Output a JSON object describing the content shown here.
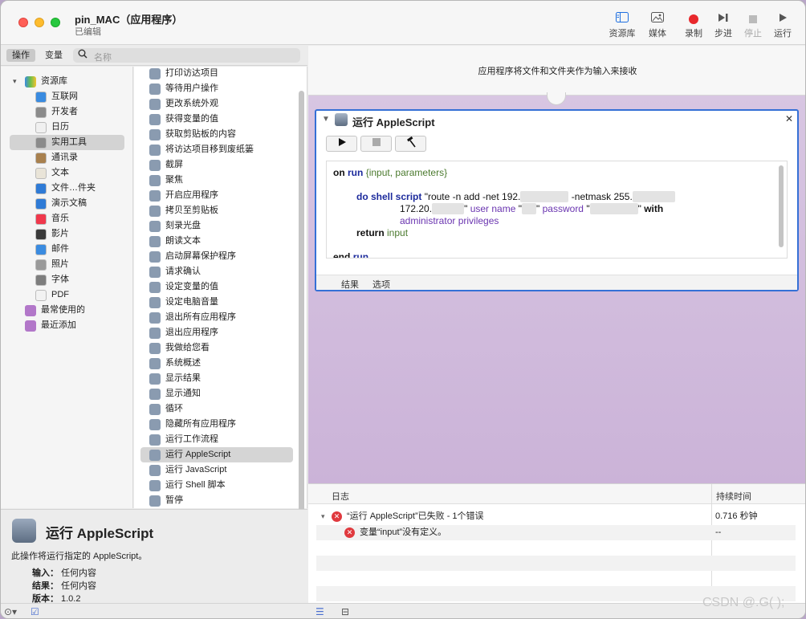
{
  "window": {
    "title": "pin_MAC（应用程序）",
    "subtitle": "已编辑"
  },
  "toolbar": {
    "library_label": "资源库",
    "media_label": "媒体",
    "record_label": "录制",
    "step_label": "步进",
    "stop_label": "停止",
    "run_label": "运行"
  },
  "left_header": {
    "actions_tab": "操作",
    "variables_tab": "变量",
    "search_placeholder": "名称"
  },
  "library": {
    "root_label": "资源库",
    "items": [
      {
        "label": "互联网",
        "color": "#3a8be0"
      },
      {
        "label": "开发者",
        "color": "#8b8b8b"
      },
      {
        "label": "日历",
        "color": "#f0f0f0"
      },
      {
        "label": "实用工具",
        "color": "#8b8b8b",
        "selected": true
      },
      {
        "label": "通讯录",
        "color": "#a8804e"
      },
      {
        "label": "文本",
        "color": "#e9e4d8"
      },
      {
        "label": "文件…件夹",
        "color": "#2f7bd6"
      },
      {
        "label": "演示文稿",
        "color": "#2f7bd6"
      },
      {
        "label": "音乐",
        "color": "#f0384c"
      },
      {
        "label": "影片",
        "color": "#3a3a3a"
      },
      {
        "label": "邮件",
        "color": "#3a8be0"
      },
      {
        "label": "照片",
        "color": "#9a9a9a"
      },
      {
        "label": "字体",
        "color": "#7d7d7d"
      },
      {
        "label": "PDF",
        "color": "#f2f2f2"
      }
    ],
    "smart_groups": [
      {
        "label": "最常使用的",
        "color": "#b277c9"
      },
      {
        "label": "最近添加",
        "color": "#b277c9"
      }
    ]
  },
  "actions": [
    {
      "label": "打印访达项目"
    },
    {
      "label": "等待用户操作"
    },
    {
      "label": "更改系统外观"
    },
    {
      "label": "获得变量的值"
    },
    {
      "label": "获取剪贴板的内容"
    },
    {
      "label": "将访达项目移到废纸篓"
    },
    {
      "label": "截屏"
    },
    {
      "label": "聚焦"
    },
    {
      "label": "开启应用程序"
    },
    {
      "label": "拷贝至剪贴板"
    },
    {
      "label": "刻录光盘"
    },
    {
      "label": "朗读文本"
    },
    {
      "label": "启动屏幕保护程序"
    },
    {
      "label": "请求确认"
    },
    {
      "label": "设定变量的值"
    },
    {
      "label": "设定电脑音量"
    },
    {
      "label": "退出所有应用程序"
    },
    {
      "label": "退出应用程序"
    },
    {
      "label": "我做给您看"
    },
    {
      "label": "系统概述"
    },
    {
      "label": "显示结果"
    },
    {
      "label": "显示通知"
    },
    {
      "label": "循环"
    },
    {
      "label": "隐藏所有应用程序"
    },
    {
      "label": "运行工作流程"
    },
    {
      "label": "运行 AppleScript",
      "selected": true
    },
    {
      "label": "运行 JavaScript"
    },
    {
      "label": "运行 Shell 脚本"
    },
    {
      "label": "暂停"
    }
  ],
  "description": {
    "title": "运行 AppleScript",
    "text": "此操作将运行指定的 AppleScript。",
    "input_label": "输入：",
    "input_value": "任何内容",
    "result_label": "结果：",
    "result_value": "任何内容",
    "version_label": "版本：",
    "version_value": "1.0.2"
  },
  "workflow": {
    "header_text": "应用程序将文件和文件夹作为输入来接收",
    "card": {
      "title": "运行 AppleScript",
      "run_icon": "play-icon",
      "stop_icon": "stop-icon",
      "compile_icon": "hammer-icon",
      "code": {
        "l1_kw1": "on",
        "l1_kw2": "run",
        "l1_args": "{input, parameters}",
        "l2_kw1": "do shell script",
        "l2_str1": "\"route -n add -net 192.",
        "l2_str2": " -netmask 255.",
        "l3_str1": "172.20.",
        "l3_str2": "\"",
        "l3_cmd1": "user name",
        "l3_str3": "\"",
        "l3_str4": "\"",
        "l3_cmd2": "password",
        "l3_str5": "\"",
        "l3_str6": "\"",
        "l3_kw": "with",
        "l4_cmd": "administrator privileges",
        "l5_kw": "return",
        "l5_var": "input",
        "l6_kw1": "end",
        "l6_kw2": "run"
      },
      "tab_results": "结果",
      "tab_options": "选项"
    }
  },
  "log": {
    "col_log": "日志",
    "col_duration": "持续时间",
    "rows": [
      {
        "text": "“运行 AppleScript”已失败 - 1个错误",
        "time": "0.716 秒钟"
      },
      {
        "text": "变量“input”没有定义。",
        "time": "--"
      }
    ]
  },
  "watermark": "CSDN @.G( );"
}
